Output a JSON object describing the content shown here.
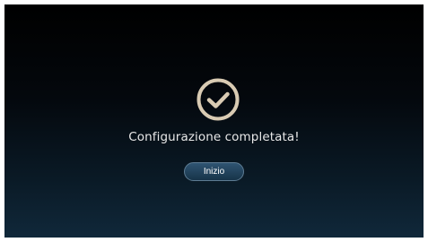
{
  "dialog": {
    "icon": "check-circle-icon",
    "message": "Configurazione completata!",
    "button_label": "Inizio"
  },
  "colors": {
    "icon": "#d9cbb3",
    "text": "#e8e8e8",
    "button_bg": "#244560",
    "button_border": "#5e7c93"
  }
}
